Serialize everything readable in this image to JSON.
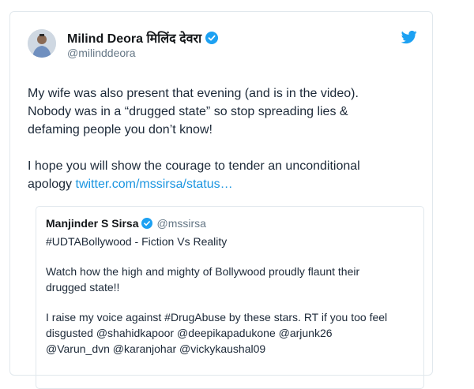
{
  "tweet": {
    "author_name": "Milind Deora मिलिंद देवरा",
    "author_handle": "@milinddeora",
    "line1": "My wife was also present that evening (and is in the video).",
    "line2": "Nobody was in a “drugged state” so stop spreading lies &",
    "line3": "defaming people you don’t know!",
    "line4": "I hope you will show the courage to tender an unconditional",
    "line5_prefix": "apology ",
    "link_text": "twitter.com/mssirsa/status…"
  },
  "quoted_tweet": {
    "author_name": "Manjinder S Sirsa",
    "author_handle": "@mssirsa",
    "line1": "#UDTABollywood - Fiction Vs Reality",
    "line2": "Watch how the high and mighty of Bollywood proudly flaunt their",
    "line3": "drugged state!!",
    "line4": "I raise my voice against #DrugAbuse by these stars. RT if you too feel",
    "line5": "disgusted @shahidkapoor @deepikapadukone @arjunk26",
    "line6": "@Varun_dvn @karanjohar @vickykaushal09"
  },
  "colors": {
    "link": "#1b95e0",
    "verified": "#1da1f2",
    "twitter_bird": "#1da1f2",
    "secondary_text": "#657786"
  },
  "icons": {
    "verified": "verified-badge-icon",
    "twitter": "twitter-bird-icon"
  }
}
